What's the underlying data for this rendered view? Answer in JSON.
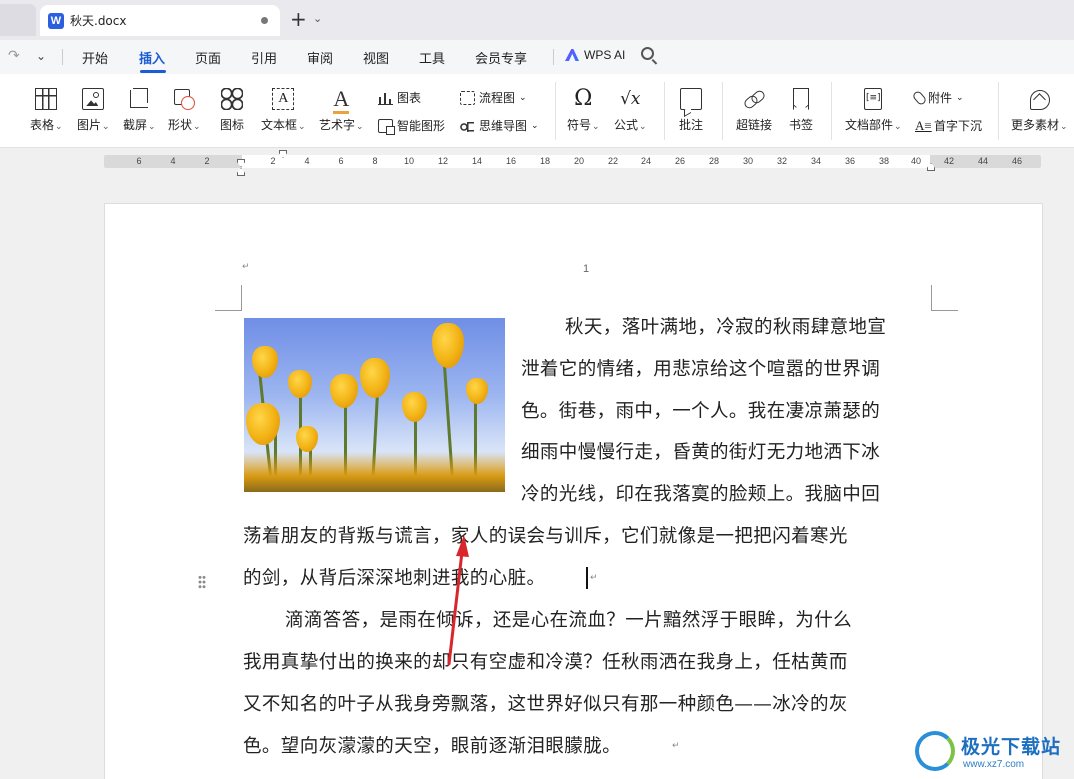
{
  "tabs": [
    {
      "title": "秋天.docx"
    }
  ],
  "menu": {
    "items": [
      "开始",
      "插入",
      "页面",
      "引用",
      "审阅",
      "视图",
      "工具",
      "会员专享"
    ],
    "active": "插入",
    "wps_ai": "WPS AI"
  },
  "ribbon": {
    "table": "表格",
    "picture": "图片",
    "screenshot": "截屏",
    "shape": "形状",
    "icon": "图标",
    "textbox": "文本框",
    "wordart": "艺术字",
    "chart": "图表",
    "smartart": "智能图形",
    "flowchart": "流程图",
    "mindmap": "思维导图",
    "symbol": "符号",
    "formula": "公式",
    "comment": "批注",
    "hyperlink": "超链接",
    "bookmark": "书签",
    "docpart": "文档部件",
    "attachment": "附件",
    "dropcap": "首字下沉",
    "more": "更多素材"
  },
  "ruler": {
    "left_numbers": [
      "6",
      "4",
      "2"
    ],
    "numbers": [
      "2",
      "4",
      "6",
      "8",
      "10",
      "12",
      "14",
      "16",
      "18",
      "20",
      "22",
      "24",
      "26",
      "28",
      "30",
      "32",
      "34",
      "36",
      "38",
      "40",
      "42",
      "44",
      "46"
    ]
  },
  "document": {
    "page_number": "1",
    "return_mark": "↵",
    "lines": [
      "秋天，落叶满地，冷寂的秋雨肆意地宣",
      "泄着它的情绪，用悲凉给这个喧嚣的世界调",
      "色。街巷，雨中，一个人。我在凄凉萧瑟的",
      "细雨中慢慢行走，昏黄的街灯无力地洒下冰",
      "冷的光线，印在我落寞的脸颊上。我脑中回",
      "荡着朋友的背叛与谎言，家人的误会与训斥，它们就像是一把把闪着寒光",
      "的剑，从背后深深地刺进我的心脏。",
      "滴滴答答，是雨在倾诉，还是心在流血？一片黯然浮于眼眸，为什么",
      "我用真挚付出的换来的却只有空虚和冷漠？任秋雨洒在我身上，任枯黄而",
      "又不知名的叶子从我身旁飘落，这世界好似只有那一种颜色——冰冷的灰",
      "色。望向灰濛濛的天空，眼前逐渐泪眼朦胧。"
    ]
  },
  "watermark": {
    "name": "极光下载站",
    "url": "www.xz7.com"
  },
  "colors": {
    "accent": "#1c5dd6",
    "arrow": "#d9262b"
  }
}
